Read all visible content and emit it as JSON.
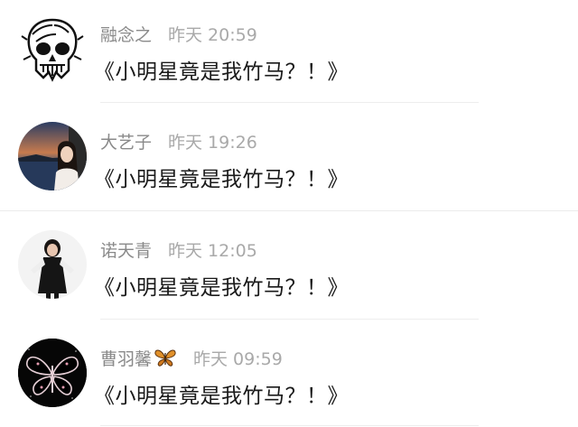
{
  "comments": [
    {
      "username": "融念之",
      "time": "昨天 20:59",
      "text": "《小明星竟是我竹马？！》",
      "avatar": "skull-avatar"
    },
    {
      "username": "大艺子",
      "time": "昨天 19:26",
      "text": "《小明星竟是我竹马？！》",
      "avatar": "lakeside-girl-avatar"
    },
    {
      "username": "诺天青",
      "time": "昨天 12:05",
      "text": "《小明星竟是我竹马？！》",
      "avatar": "girl-in-black-dress-avatar"
    },
    {
      "username": "曹羽馨",
      "time": "昨天 09:59",
      "text": "《小明星竟是我竹马？！》",
      "avatar": "butterfly-avatar",
      "badge": "butterfly-icon"
    }
  ]
}
